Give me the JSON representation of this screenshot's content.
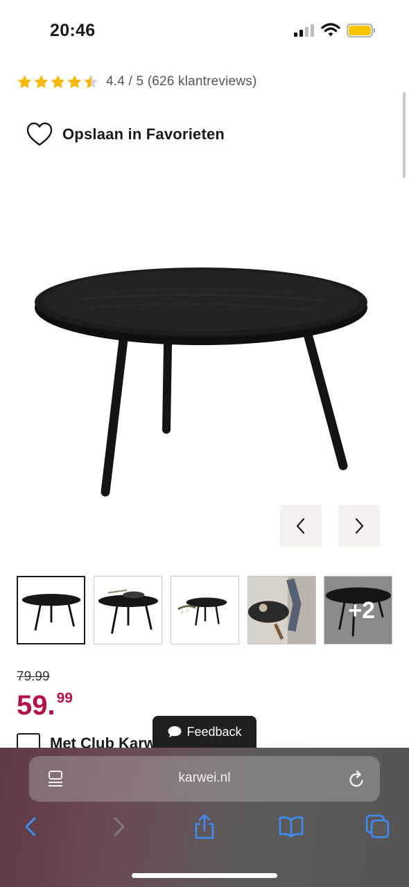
{
  "status_bar": {
    "time": "20:46"
  },
  "rating": {
    "score_text": "4.4 / 5 (626 klantreviews)",
    "stars": 4.4,
    "star_color": "#f5b800"
  },
  "favorites": {
    "label": "Opslaan in Favorieten"
  },
  "gallery": {
    "prev_icon": "chevron-left-icon",
    "next_icon": "chevron-right-icon",
    "more_label": "+2"
  },
  "pricing": {
    "old_price": "79.99",
    "price_main": "59.",
    "price_cents": "99",
    "price_color": "#b3134a"
  },
  "club": {
    "label": "Met Club Karwei"
  },
  "feedback": {
    "label": "Feedback"
  },
  "browser": {
    "url": "karwei.nl",
    "accent": "#3f8df5"
  }
}
